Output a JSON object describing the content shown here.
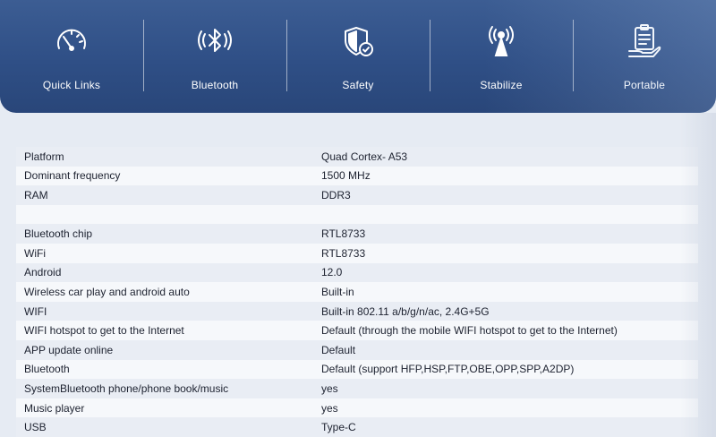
{
  "features": [
    {
      "label": "Quick Links",
      "icon": "speedometer-icon"
    },
    {
      "label": "Bluetooth",
      "icon": "bluetooth-icon"
    },
    {
      "label": "Safety",
      "icon": "shield-check-icon"
    },
    {
      "label": "Stabilize",
      "icon": "antenna-icon"
    },
    {
      "label": "Portable",
      "icon": "clipboard-hand-icon"
    }
  ],
  "specs": [
    {
      "key": "Platform",
      "value": "Quad Cortex- A53"
    },
    {
      "key": "Dominant frequency",
      "value": "1500 MHz"
    },
    {
      "key": "RAM",
      "value": "DDR3"
    },
    {
      "key": "",
      "value": ""
    },
    {
      "key": "Bluetooth chip",
      "value": "RTL8733"
    },
    {
      "key": "WiFi",
      "value": "RTL8733"
    },
    {
      "key": "Android",
      "value": "12.0"
    },
    {
      "key": "Wireless car play and android auto",
      "value": "Built-in"
    },
    {
      "key": "WIFI",
      "value": "Built-in 802.11 a/b/g/n/ac, 2.4G+5G"
    },
    {
      "key": "WIFI hotspot to get to the Internet",
      "value": "Default (through the mobile WIFI hotspot to get to the Internet)"
    },
    {
      "key": "APP update online",
      "value": "Default"
    },
    {
      "key": "Bluetooth",
      "value": "Default (support HFP,HSP,FTP,OBE,OPP,SPP,A2DP)"
    },
    {
      "key": "SystemBluetooth phone/phone book/music",
      "value": "yes"
    },
    {
      "key": "Music player",
      "value": "yes"
    },
    {
      "key": "USB",
      "value": "Type-C"
    }
  ],
  "colors": {
    "banner": "#2f4f86",
    "text": "#1d2230",
    "row_alt": "#e9edf4"
  }
}
